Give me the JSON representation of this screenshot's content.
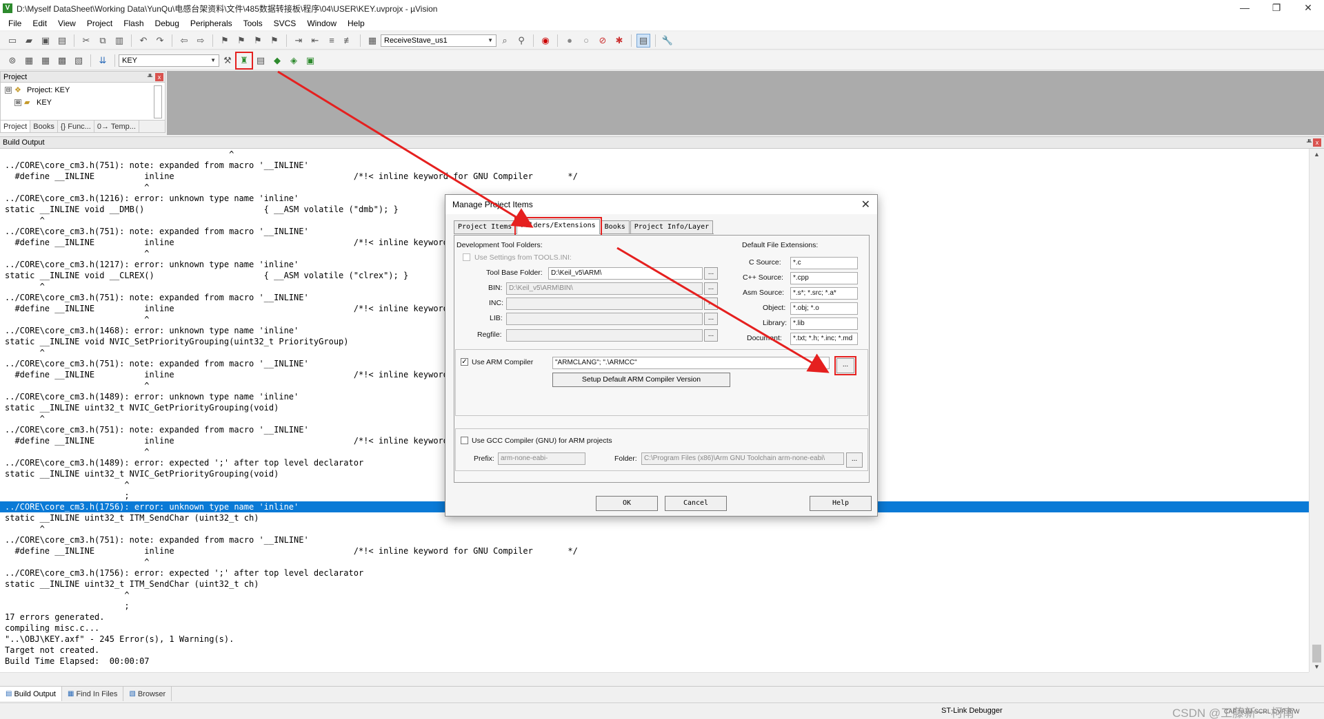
{
  "window": {
    "title": "D:\\Myself DataSheet\\Working Data\\YunQu\\电感台架资料\\文件\\485数据转接板\\程序\\04\\USER\\KEY.uvprojx - µVision",
    "icon_label": "V",
    "minimize": "—",
    "restore": "❐",
    "close": "✕"
  },
  "menu": [
    "File",
    "Edit",
    "View",
    "Project",
    "Flash",
    "Debug",
    "Peripherals",
    "Tools",
    "SVCS",
    "Window",
    "Help"
  ],
  "toolbar1": {
    "target_combo": "ReceiveStave_us1"
  },
  "toolbar2": {
    "target_combo": "KEY"
  },
  "project_pane": {
    "title": "Project",
    "pin": "ᚇ",
    "close": "x",
    "tree": [
      {
        "label": "Project: KEY",
        "expander": "⊟"
      },
      {
        "label": "KEY",
        "expander": "⊞"
      }
    ],
    "tabs": [
      "Project",
      "Books",
      "{} Func...",
      "0→ Temp..."
    ]
  },
  "build_output": {
    "title": "Build Output",
    "lines": [
      {
        "text": "                                             ^",
        "selected": false
      },
      {
        "text": "../CORE\\core_cm3.h(751): note: expanded from macro '__INLINE'",
        "selected": false
      },
      {
        "text": "  #define __INLINE          inline                                    /*!< inline keyword for GNU Compiler       */",
        "selected": false
      },
      {
        "text": "                            ^",
        "selected": false
      },
      {
        "text": "../CORE\\core_cm3.h(1216): error: unknown type name 'inline'",
        "selected": false
      },
      {
        "text": "static __INLINE void __DMB()                        { __ASM volatile (\"dmb\"); }",
        "selected": false
      },
      {
        "text": "       ^",
        "selected": false
      },
      {
        "text": "../CORE\\core_cm3.h(751): note: expanded from macro '__INLINE'",
        "selected": false
      },
      {
        "text": "  #define __INLINE          inline                                    /*!< inline keyword for GNU Compiler       */",
        "selected": false
      },
      {
        "text": "                            ^",
        "selected": false
      },
      {
        "text": "../CORE\\core_cm3.h(1217): error: unknown type name 'inline'",
        "selected": false
      },
      {
        "text": "static __INLINE void __CLREX()                      { __ASM volatile (\"clrex\"); }",
        "selected": false
      },
      {
        "text": "       ^",
        "selected": false
      },
      {
        "text": "../CORE\\core_cm3.h(751): note: expanded from macro '__INLINE'",
        "selected": false
      },
      {
        "text": "  #define __INLINE          inline                                    /*!< inline keyword for GNU Compiler       */",
        "selected": false
      },
      {
        "text": "                            ^",
        "selected": false
      },
      {
        "text": "../CORE\\core_cm3.h(1468): error: unknown type name 'inline'",
        "selected": false
      },
      {
        "text": "static __INLINE void NVIC_SetPriorityGrouping(uint32_t PriorityGroup)",
        "selected": false
      },
      {
        "text": "       ^",
        "selected": false
      },
      {
        "text": "../CORE\\core_cm3.h(751): note: expanded from macro '__INLINE'",
        "selected": false
      },
      {
        "text": "  #define __INLINE          inline                                    /*!< inline keyword for GNU Compiler       */",
        "selected": false
      },
      {
        "text": "                            ^",
        "selected": false
      },
      {
        "text": "../CORE\\core_cm3.h(1489): error: unknown type name 'inline'",
        "selected": false
      },
      {
        "text": "static __INLINE uint32_t NVIC_GetPriorityGrouping(void)",
        "selected": false
      },
      {
        "text": "       ^",
        "selected": false
      },
      {
        "text": "../CORE\\core_cm3.h(751): note: expanded from macro '__INLINE'",
        "selected": false
      },
      {
        "text": "  #define __INLINE          inline                                    /*!< inline keyword for GNU Compiler       */",
        "selected": false
      },
      {
        "text": "                            ^",
        "selected": false
      },
      {
        "text": "../CORE\\core_cm3.h(1489): error: expected ';' after top level declarator",
        "selected": false
      },
      {
        "text": "static __INLINE uint32_t NVIC_GetPriorityGrouping(void)",
        "selected": false
      },
      {
        "text": "                        ^",
        "selected": false
      },
      {
        "text": "                        ;",
        "selected": false
      },
      {
        "text": "../CORE\\core_cm3.h(1756): error: unknown type name 'inline'",
        "selected": true
      },
      {
        "text": "static __INLINE uint32_t ITM_SendChar (uint32_t ch)",
        "selected": false
      },
      {
        "text": "       ^",
        "selected": false
      },
      {
        "text": "../CORE\\core_cm3.h(751): note: expanded from macro '__INLINE'",
        "selected": false
      },
      {
        "text": "  #define __INLINE          inline                                    /*!< inline keyword for GNU Compiler       */",
        "selected": false
      },
      {
        "text": "                            ^",
        "selected": false
      },
      {
        "text": "../CORE\\core_cm3.h(1756): error: expected ';' after top level declarator",
        "selected": false
      },
      {
        "text": "static __INLINE uint32_t ITM_SendChar (uint32_t ch)",
        "selected": false
      },
      {
        "text": "                        ^",
        "selected": false
      },
      {
        "text": "                        ;",
        "selected": false
      },
      {
        "text": "17 errors generated.",
        "selected": false
      },
      {
        "text": "compiling misc.c...",
        "selected": false
      },
      {
        "text": "\"..\\OBJ\\KEY.axf\" - 245 Error(s), 1 Warning(s).",
        "selected": false
      },
      {
        "text": "Target not created.",
        "selected": false
      },
      {
        "text": "Build Time Elapsed:  00:00:07",
        "selected": false
      }
    ]
  },
  "bottom_tabs": [
    "Build Output",
    "Find In Files",
    "Browser"
  ],
  "status": {
    "debugger": "ST-Link Debugger",
    "flags": "CAP  NUM  SCRL  OVR  R/W",
    "watermark": "CSDN @工藤新一 柯南"
  },
  "dialog": {
    "title": "Manage Project Items",
    "close": "✕",
    "tabs": [
      "Project Items",
      "Folders/Extensions",
      "Books",
      "Project Info/Layer"
    ],
    "active_tab": "Folders/Extensions",
    "dev_folders_label": "Development Tool Folders:",
    "use_settings_label": "Use Settings from TOOLS.INI:",
    "tool_base_label": "Tool Base Folder:",
    "tool_base_value": "D:\\Keil_v5\\ARM\\",
    "bin_label": "BIN:",
    "bin_value": "D:\\Keil_v5\\ARM\\BIN\\",
    "inc_label": "INC:",
    "inc_value": "",
    "lib_label": "LIB:",
    "lib_value": "",
    "regfile_label": "Regfile:",
    "regfile_value": "",
    "browse": "...",
    "default_ext_label": "Default File Extensions:",
    "c_source_label": "C Source:",
    "c_source_value": "*.c",
    "cpp_source_label": "C++ Source:",
    "cpp_source_value": "*.cpp",
    "asm_source_label": "Asm Source:",
    "asm_source_value": "*.s*; *.src; *.a*",
    "object_label": "Object:",
    "object_value": "*.obj; *.o",
    "library_label": "Library:",
    "library_value": "*.lib",
    "document_label": "Document:",
    "document_value": "*.txt; *.h; *.inc; *.md",
    "use_arm_label": "Use ARM Compiler",
    "use_arm_checked": "✓",
    "arm_compiler_value": "\"ARMCLANG\"; \".\\ARMCC\"",
    "setup_default_label": "Setup Default ARM Compiler Version",
    "use_gcc_label": "Use GCC Compiler (GNU) for ARM projects",
    "prefix_label": "Prefix:",
    "prefix_value": "arm-none-eabi-",
    "folder_label": "Folder:",
    "folder_value": "C:\\Program Files (x86)\\Arm GNU Toolchain arm-none-eabi\\",
    "ok": "OK",
    "cancel": "Cancel",
    "help": "Help"
  },
  "colors": {
    "selection": "#0a7ad6",
    "annotation_red": "#e5201f",
    "gray_area": "#ababab"
  }
}
